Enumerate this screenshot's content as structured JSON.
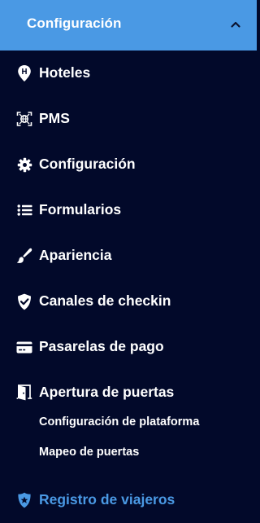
{
  "header": {
    "title": "Configuración",
    "chevron_icon": "chevron-up-icon"
  },
  "menu": {
    "items": [
      {
        "label": "Hoteles",
        "icon": "hotel-pin-icon"
      },
      {
        "label": "PMS",
        "icon": "network-globe-icon"
      },
      {
        "label": "Configuración",
        "icon": "gear-icon"
      },
      {
        "label": "Formularios",
        "icon": "list-icon"
      },
      {
        "label": "Apariencia",
        "icon": "paintbrush-icon"
      },
      {
        "label": "Canales de checkin",
        "icon": "shield-check-icon"
      },
      {
        "label": "Pasarelas de pago",
        "icon": "credit-card-icon"
      },
      {
        "label": "Apertura de puertas",
        "icon": "door-open-icon"
      },
      {
        "label": "Registro de viajeros",
        "icon": "police-badge-icon"
      }
    ],
    "subitems": [
      {
        "label": "Configuración de plataforma"
      },
      {
        "label": "Mapeo de puertas"
      }
    ]
  },
  "colors": {
    "background": "#02092a",
    "header": "#4a99e4",
    "text": "#ffffff",
    "active": "#4a99e4"
  }
}
